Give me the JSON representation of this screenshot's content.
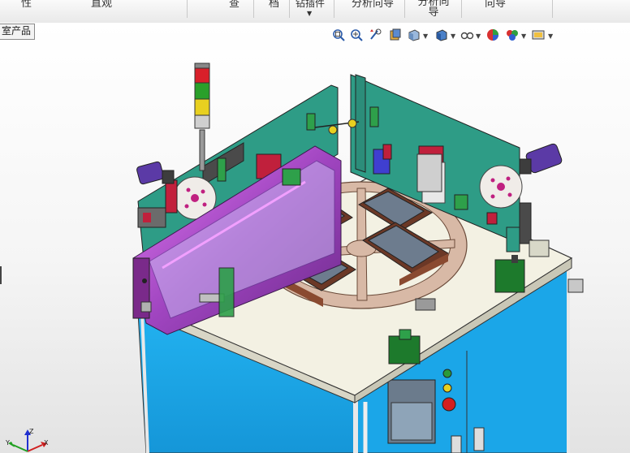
{
  "ribbon": {
    "items": [
      {
        "label": "性"
      },
      {
        "label": "直观"
      },
      {
        "label": "查"
      },
      {
        "label": "档"
      },
      {
        "label": "钻插件"
      },
      {
        "label": "分析向导"
      },
      {
        "label": "分析向导"
      },
      {
        "label": "向导"
      }
    ]
  },
  "document_tab": {
    "label": "室产品"
  },
  "heads_up_toolbar": {
    "icons": [
      "zoom-to-fit-icon",
      "zoom-area-icon",
      "previous-view-icon",
      "section-view-icon",
      "view-orientation-icon",
      "display-style-icon",
      "hide-show-items-icon",
      "edit-appearance-icon",
      "apply-scene-icon",
      "view-settings-icon"
    ]
  },
  "triad": {
    "x_label": "X",
    "y_label": "Y",
    "z_label": "Z"
  },
  "colors": {
    "cabinet_blue": "#1aa3e6",
    "table_top": "#f3f1e3",
    "plate_green": "#2e9c86",
    "turntable": "#d9b8a5",
    "fixture_brown": "#6b3826",
    "cover_purple": "#8a39a8",
    "motor_purple": "#5b3aa6",
    "button_green": "#1d7a2c"
  }
}
